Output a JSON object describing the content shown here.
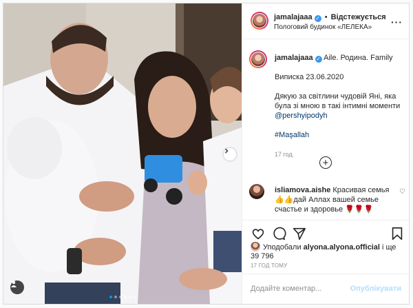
{
  "header": {
    "username": "jamalajaaa",
    "follow_state": "Відстежується",
    "separator": "•",
    "location": "Пологовий будинок «ЛЕЛЕКА»",
    "more_icon": "more-horizontal-icon"
  },
  "caption": {
    "username": "jamalajaaa",
    "title": "Aile. Родина. Family",
    "line1": "Виписка 23.06.2020",
    "line2": "Дякую за світлини чудовій Яні, яка була зі мною в такі інтимні моменти",
    "mention": "@pershyipodyh",
    "hashtag": "#Maşallah",
    "time": "17 год."
  },
  "load_more_icon": "plus-circle-icon",
  "comment": {
    "username": "isliamova.aishe",
    "text": "Красивая семья 👍👍дай Аллах вашей семье счастье и здоровье 🌹🌹🌹"
  },
  "likes": {
    "prefix": "Уподобали",
    "user": "alyona.alyona.official",
    "suffix": "і ще 39 796"
  },
  "time_ago": "17 ГОД ТОМУ",
  "composer": {
    "placeholder": "Додайте коментар...",
    "post_label": "Опублікувати"
  },
  "carousel": {
    "dots": 6,
    "active_index": 0
  },
  "colors": {
    "accent": "#0095f6",
    "link": "#00376b",
    "verified": "#3897f0",
    "post_disabled": "#b2dffc"
  }
}
